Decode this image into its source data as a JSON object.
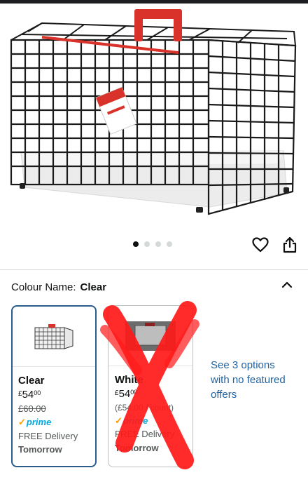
{
  "product": {
    "image_alt": "Black wire pet carrier cage with red carry handle and white tray"
  },
  "gallery": {
    "image_count": 4,
    "active_index": 0
  },
  "actions": {
    "wishlist_icon": "heart-icon",
    "share_icon": "share-icon"
  },
  "variation": {
    "label": "Colour Name:",
    "selected_value": "Clear",
    "collapse_icon": "chevron-up-icon",
    "options": [
      {
        "name": "Clear",
        "price_symbol": "£",
        "price_whole": "54",
        "price_fraction": "00",
        "was_price": "£60.00",
        "prime": "prime",
        "delivery": "FREE Delivery",
        "delivery_when": "Tomorrow",
        "selected": true
      },
      {
        "name": "White",
        "price_symbol": "£",
        "price_whole": "54",
        "price_fraction": "00",
        "unit_price": "(£54.00 / count)",
        "prime": "prime",
        "delivery": "FREE Delivery",
        "delivery_when": "Tomorrow",
        "selected": false,
        "crossed_out": true
      }
    ],
    "more_options": "See 3 options with no featured offers"
  },
  "colors": {
    "accent_border": "#2a5d8c",
    "link": "#2162a1",
    "prime_blue": "#00a8e1",
    "cross_red": "#ff0000"
  }
}
